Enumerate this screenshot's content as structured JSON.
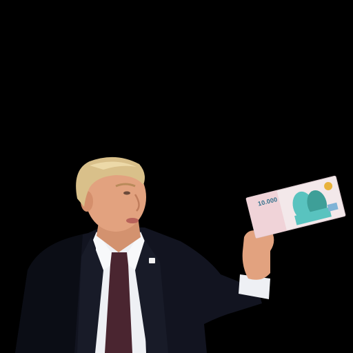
{
  "photo": {
    "background_color": "#000000",
    "subject": {
      "hair_color": "#d9c08a",
      "skin_color": "#e2a27f",
      "suit_color": "#121420",
      "shirt_color": "#eef0f4",
      "tie_color": "#4a2530"
    },
    "banknote": {
      "value_text": "10.000",
      "paper_color": "#f3e8ea",
      "accent_color": "#59c3bf",
      "portrait_color": "#3e9f98",
      "seal_color": "#e8b23c"
    }
  }
}
